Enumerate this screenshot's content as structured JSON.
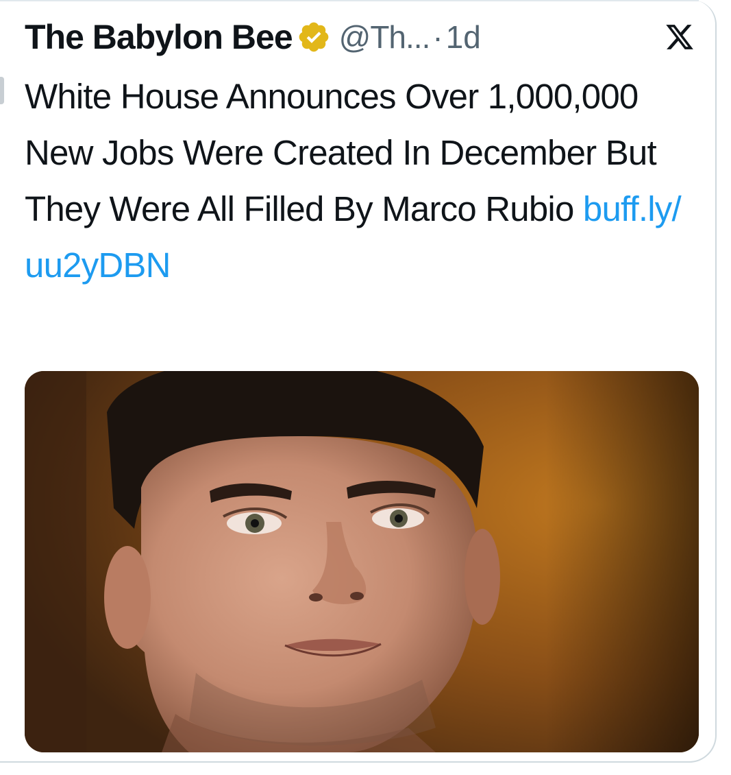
{
  "tweet": {
    "author_name": "The Babylon Bee",
    "handle": "@Th...",
    "separator": "·",
    "time": "1d",
    "text": "White House Announces Over 1,000,000 New Jobs Were Created In December But They Were All Filled By Marco Rubio ",
    "link_line1": "buff.ly/",
    "link_line2": "uu2yDBN"
  },
  "icons": {
    "verified": "verified-badge-icon",
    "platform": "x-logo-icon"
  },
  "colors": {
    "verified_gold": "#e2b719",
    "link_blue": "#1d9bf0",
    "text_primary": "#0f1419",
    "text_secondary": "#536471"
  }
}
